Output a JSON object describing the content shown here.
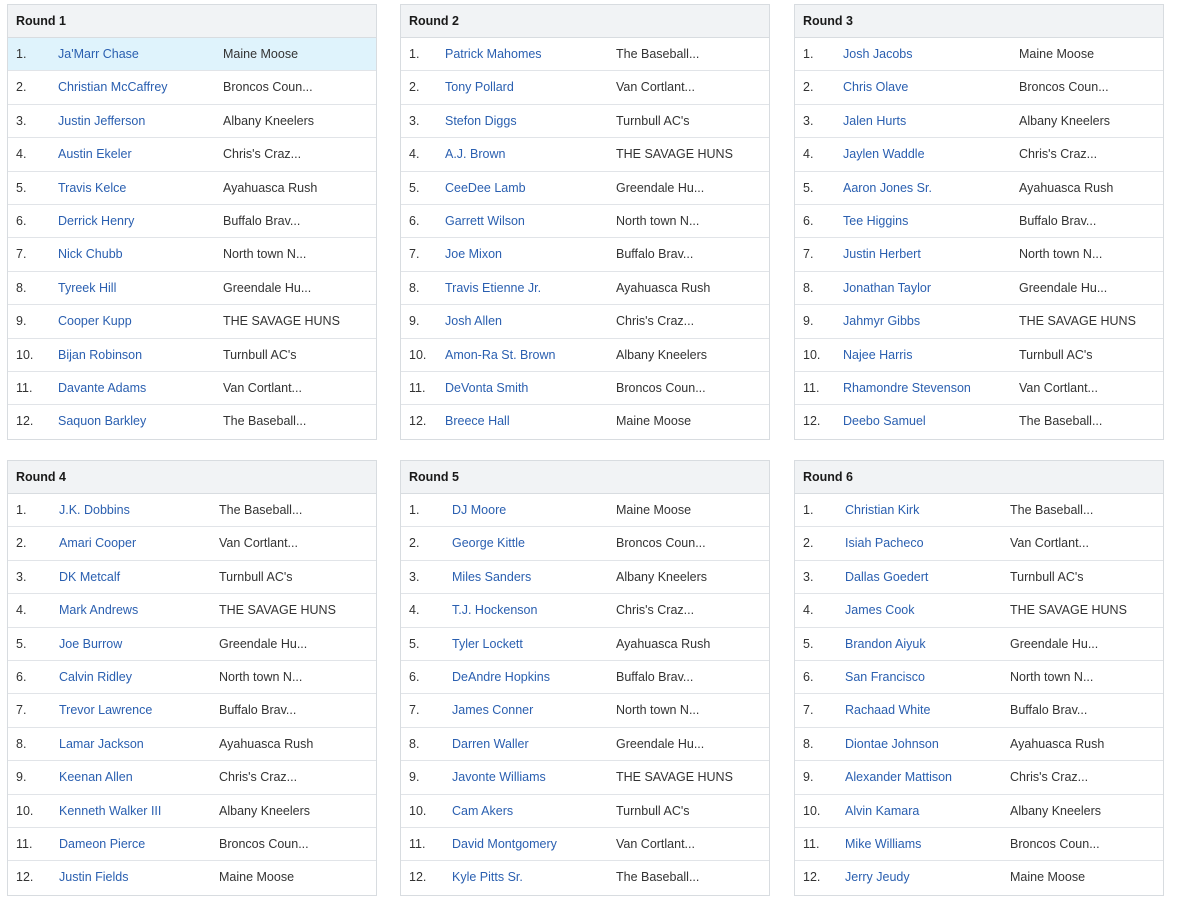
{
  "rounds": [
    {
      "title": "Round 1",
      "picks": [
        {
          "num": "1.",
          "player": "Ja'Marr Chase",
          "team": "Maine Moose"
        },
        {
          "num": "2.",
          "player": "Christian McCaffrey",
          "team": "Broncos Coun..."
        },
        {
          "num": "3.",
          "player": "Justin Jefferson",
          "team": "Albany Kneelers"
        },
        {
          "num": "4.",
          "player": "Austin Ekeler",
          "team": "Chris's Craz..."
        },
        {
          "num": "5.",
          "player": "Travis Kelce",
          "team": "Ayahuasca Rush"
        },
        {
          "num": "6.",
          "player": "Derrick Henry",
          "team": "Buffalo Brav..."
        },
        {
          "num": "7.",
          "player": "Nick Chubb",
          "team": "North town N..."
        },
        {
          "num": "8.",
          "player": "Tyreek Hill",
          "team": "Greendale Hu..."
        },
        {
          "num": "9.",
          "player": "Cooper Kupp",
          "team": "THE SAVAGE HUNS"
        },
        {
          "num": "10.",
          "player": "Bijan Robinson",
          "team": "Turnbull AC's"
        },
        {
          "num": "11.",
          "player": "Davante Adams",
          "team": "Van Cortlant..."
        },
        {
          "num": "12.",
          "player": "Saquon Barkley",
          "team": "The Baseball..."
        }
      ]
    },
    {
      "title": "Round 2",
      "picks": [
        {
          "num": "1.",
          "player": "Patrick Mahomes",
          "team": "The Baseball..."
        },
        {
          "num": "2.",
          "player": "Tony Pollard",
          "team": "Van Cortlant..."
        },
        {
          "num": "3.",
          "player": "Stefon Diggs",
          "team": "Turnbull AC's"
        },
        {
          "num": "4.",
          "player": "A.J. Brown",
          "team": "THE SAVAGE HUNS"
        },
        {
          "num": "5.",
          "player": "CeeDee Lamb",
          "team": "Greendale Hu..."
        },
        {
          "num": "6.",
          "player": "Garrett Wilson",
          "team": "North town N..."
        },
        {
          "num": "7.",
          "player": "Joe Mixon",
          "team": "Buffalo Brav..."
        },
        {
          "num": "8.",
          "player": "Travis Etienne Jr.",
          "team": "Ayahuasca Rush"
        },
        {
          "num": "9.",
          "player": "Josh Allen",
          "team": "Chris's Craz..."
        },
        {
          "num": "10.",
          "player": "Amon-Ra St. Brown",
          "team": "Albany Kneelers"
        },
        {
          "num": "11.",
          "player": "DeVonta Smith",
          "team": "Broncos Coun..."
        },
        {
          "num": "12.",
          "player": "Breece Hall",
          "team": "Maine Moose"
        }
      ]
    },
    {
      "title": "Round 3",
      "picks": [
        {
          "num": "1.",
          "player": "Josh Jacobs",
          "team": "Maine Moose"
        },
        {
          "num": "2.",
          "player": "Chris Olave",
          "team": "Broncos Coun..."
        },
        {
          "num": "3.",
          "player": "Jalen Hurts",
          "team": "Albany Kneelers"
        },
        {
          "num": "4.",
          "player": "Jaylen Waddle",
          "team": "Chris's Craz..."
        },
        {
          "num": "5.",
          "player": "Aaron Jones Sr.",
          "team": "Ayahuasca Rush"
        },
        {
          "num": "6.",
          "player": "Tee Higgins",
          "team": "Buffalo Brav..."
        },
        {
          "num": "7.",
          "player": "Justin Herbert",
          "team": "North town N..."
        },
        {
          "num": "8.",
          "player": "Jonathan Taylor",
          "team": "Greendale Hu..."
        },
        {
          "num": "9.",
          "player": "Jahmyr Gibbs",
          "team": "THE SAVAGE HUNS"
        },
        {
          "num": "10.",
          "player": "Najee Harris",
          "team": "Turnbull AC's"
        },
        {
          "num": "11.",
          "player": "Rhamondre Stevenson",
          "team": "Van Cortlant..."
        },
        {
          "num": "12.",
          "player": "Deebo Samuel",
          "team": "The Baseball..."
        }
      ]
    },
    {
      "title": "Round 4",
      "picks": [
        {
          "num": "1.",
          "player": "J.K. Dobbins",
          "team": "The Baseball..."
        },
        {
          "num": "2.",
          "player": "Amari Cooper",
          "team": "Van Cortlant..."
        },
        {
          "num": "3.",
          "player": "DK Metcalf",
          "team": "Turnbull AC's"
        },
        {
          "num": "4.",
          "player": "Mark Andrews",
          "team": "THE SAVAGE HUNS"
        },
        {
          "num": "5.",
          "player": "Joe Burrow",
          "team": "Greendale Hu..."
        },
        {
          "num": "6.",
          "player": "Calvin Ridley",
          "team": "North town N..."
        },
        {
          "num": "7.",
          "player": "Trevor Lawrence",
          "team": "Buffalo Brav..."
        },
        {
          "num": "8.",
          "player": "Lamar Jackson",
          "team": "Ayahuasca Rush"
        },
        {
          "num": "9.",
          "player": "Keenan Allen",
          "team": "Chris's Craz..."
        },
        {
          "num": "10.",
          "player": "Kenneth Walker III",
          "team": "Albany Kneelers"
        },
        {
          "num": "11.",
          "player": "Dameon Pierce",
          "team": "Broncos Coun..."
        },
        {
          "num": "12.",
          "player": "Justin Fields",
          "team": "Maine Moose"
        }
      ]
    },
    {
      "title": "Round 5",
      "picks": [
        {
          "num": "1.",
          "player": "DJ Moore",
          "team": "Maine Moose"
        },
        {
          "num": "2.",
          "player": "George Kittle",
          "team": "Broncos Coun..."
        },
        {
          "num": "3.",
          "player": "Miles Sanders",
          "team": "Albany Kneelers"
        },
        {
          "num": "4.",
          "player": "T.J. Hockenson",
          "team": "Chris's Craz..."
        },
        {
          "num": "5.",
          "player": "Tyler Lockett",
          "team": "Ayahuasca Rush"
        },
        {
          "num": "6.",
          "player": "DeAndre Hopkins",
          "team": "Buffalo Brav..."
        },
        {
          "num": "7.",
          "player": "James Conner",
          "team": "North town N..."
        },
        {
          "num": "8.",
          "player": "Darren Waller",
          "team": "Greendale Hu..."
        },
        {
          "num": "9.",
          "player": "Javonte Williams",
          "team": "THE SAVAGE HUNS"
        },
        {
          "num": "10.",
          "player": "Cam Akers",
          "team": "Turnbull AC's"
        },
        {
          "num": "11.",
          "player": "David Montgomery",
          "team": "Van Cortlant..."
        },
        {
          "num": "12.",
          "player": "Kyle Pitts Sr.",
          "team": "The Baseball..."
        }
      ]
    },
    {
      "title": "Round 6",
      "picks": [
        {
          "num": "1.",
          "player": "Christian Kirk",
          "team": "The Baseball..."
        },
        {
          "num": "2.",
          "player": "Isiah Pacheco",
          "team": "Van Cortlant..."
        },
        {
          "num": "3.",
          "player": "Dallas Goedert",
          "team": "Turnbull AC's"
        },
        {
          "num": "4.",
          "player": "James Cook",
          "team": "THE SAVAGE HUNS"
        },
        {
          "num": "5.",
          "player": "Brandon Aiyuk",
          "team": "Greendale Hu..."
        },
        {
          "num": "6.",
          "player": "San Francisco",
          "team": "North town N..."
        },
        {
          "num": "7.",
          "player": "Rachaad White",
          "team": "Buffalo Brav..."
        },
        {
          "num": "8.",
          "player": "Diontae Johnson",
          "team": "Ayahuasca Rush"
        },
        {
          "num": "9.",
          "player": "Alexander Mattison",
          "team": "Chris's Craz..."
        },
        {
          "num": "10.",
          "player": "Alvin Kamara",
          "team": "Albany Kneelers"
        },
        {
          "num": "11.",
          "player": "Mike Williams",
          "team": "Broncos Coun..."
        },
        {
          "num": "12.",
          "player": "Jerry Jeudy",
          "team": "Maine Moose"
        }
      ]
    }
  ]
}
